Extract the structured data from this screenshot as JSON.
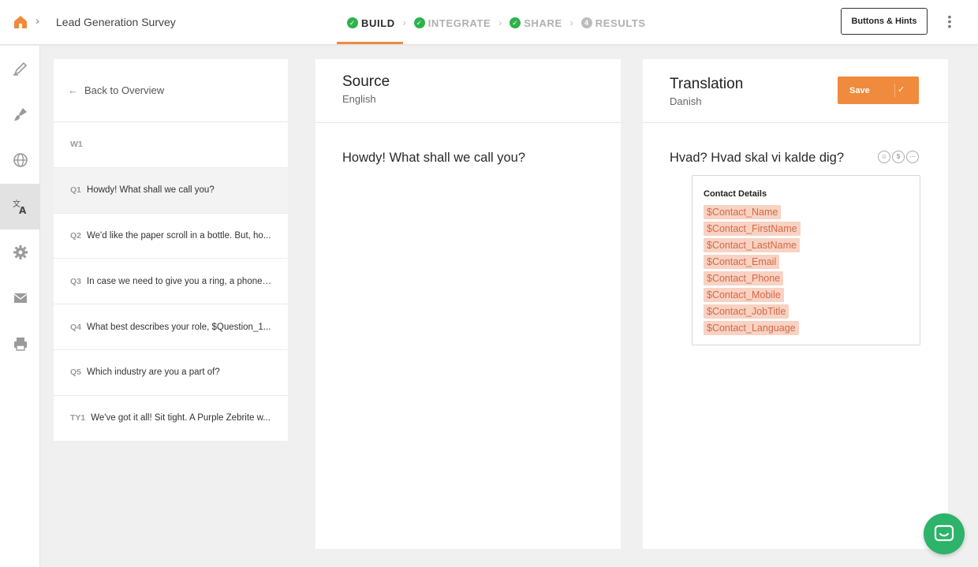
{
  "header": {
    "survey_title": "Lead Generation Survey",
    "steps": [
      {
        "label": "BUILD",
        "state": "complete-active"
      },
      {
        "label": "INTEGRATE",
        "state": "complete"
      },
      {
        "label": "SHARE",
        "state": "complete"
      },
      {
        "label": "RESULTS",
        "number": "4",
        "state": "pending"
      }
    ],
    "hints_button": "Buttons & Hints"
  },
  "rail": {
    "items": [
      {
        "icon": "pencil-icon"
      },
      {
        "icon": "paintbrush-icon"
      },
      {
        "icon": "globe-icon"
      },
      {
        "icon": "translate-icon",
        "active": true
      },
      {
        "icon": "gear-icon"
      },
      {
        "icon": "envelope-icon"
      },
      {
        "icon": "printer-icon"
      }
    ]
  },
  "questions": {
    "back_label": "Back to Overview",
    "items": [
      {
        "id": "W1",
        "text": ""
      },
      {
        "id": "Q1",
        "text": "Howdy! What shall we call you?",
        "active": true
      },
      {
        "id": "Q2",
        "text": "We'd like the paper scroll in a bottle. But, ho..."
      },
      {
        "id": "Q3",
        "text": "In case we need to give you a ring, a phone ..."
      },
      {
        "id": "Q4",
        "text": "What best describes your role, $Question_1..."
      },
      {
        "id": "Q5",
        "text": "Which industry are you a part of?"
      },
      {
        "id": "TY1",
        "text": "We've got it all! Sit tight. A Purple Zebrite w..."
      }
    ]
  },
  "source": {
    "title": "Source",
    "language": "English",
    "question": "Howdy! What shall we call you?"
  },
  "translation": {
    "title": "Translation",
    "language": "Danish",
    "save_label": "Save",
    "question": "Hvad? Hvad skal vi kalde dig?",
    "contact_heading": "Contact Details",
    "tags": [
      "$Contact_Name",
      "$Contact_FirstName",
      "$Contact_LastName",
      "$Contact_Email",
      "$Contact_Phone",
      "$Contact_Mobile",
      "$Contact_JobTitle",
      "$Contact_Language"
    ]
  },
  "colors": {
    "accent_orange": "#f08a3c",
    "success_green": "#2db34a",
    "chat_green": "#2db36a",
    "tag_bg": "#f8d2c3",
    "tag_text": "#d56a47"
  }
}
